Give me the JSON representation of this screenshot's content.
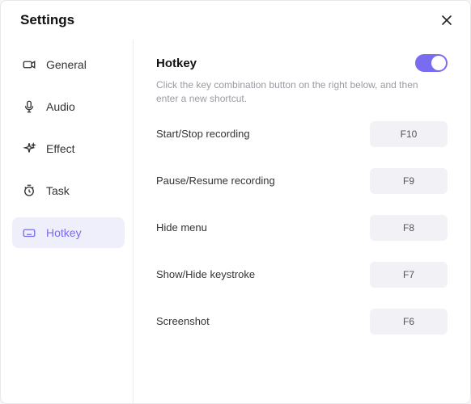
{
  "window": {
    "title": "Settings"
  },
  "sidebar": {
    "items": [
      {
        "label": "General"
      },
      {
        "label": "Audio"
      },
      {
        "label": "Effect"
      },
      {
        "label": "Task"
      },
      {
        "label": "Hotkey"
      }
    ]
  },
  "hotkey": {
    "title": "Hotkey",
    "desc": "Click the key combination button on the right below, and then enter a new shortcut.",
    "toggle_on": true,
    "rows": [
      {
        "label": "Start/Stop recording",
        "key": "F10"
      },
      {
        "label": "Pause/Resume recording",
        "key": "F9"
      },
      {
        "label": "Hide menu",
        "key": "F8"
      },
      {
        "label": "Show/Hide keystroke",
        "key": "F7"
      },
      {
        "label": "Screenshot",
        "key": "F6"
      }
    ]
  }
}
